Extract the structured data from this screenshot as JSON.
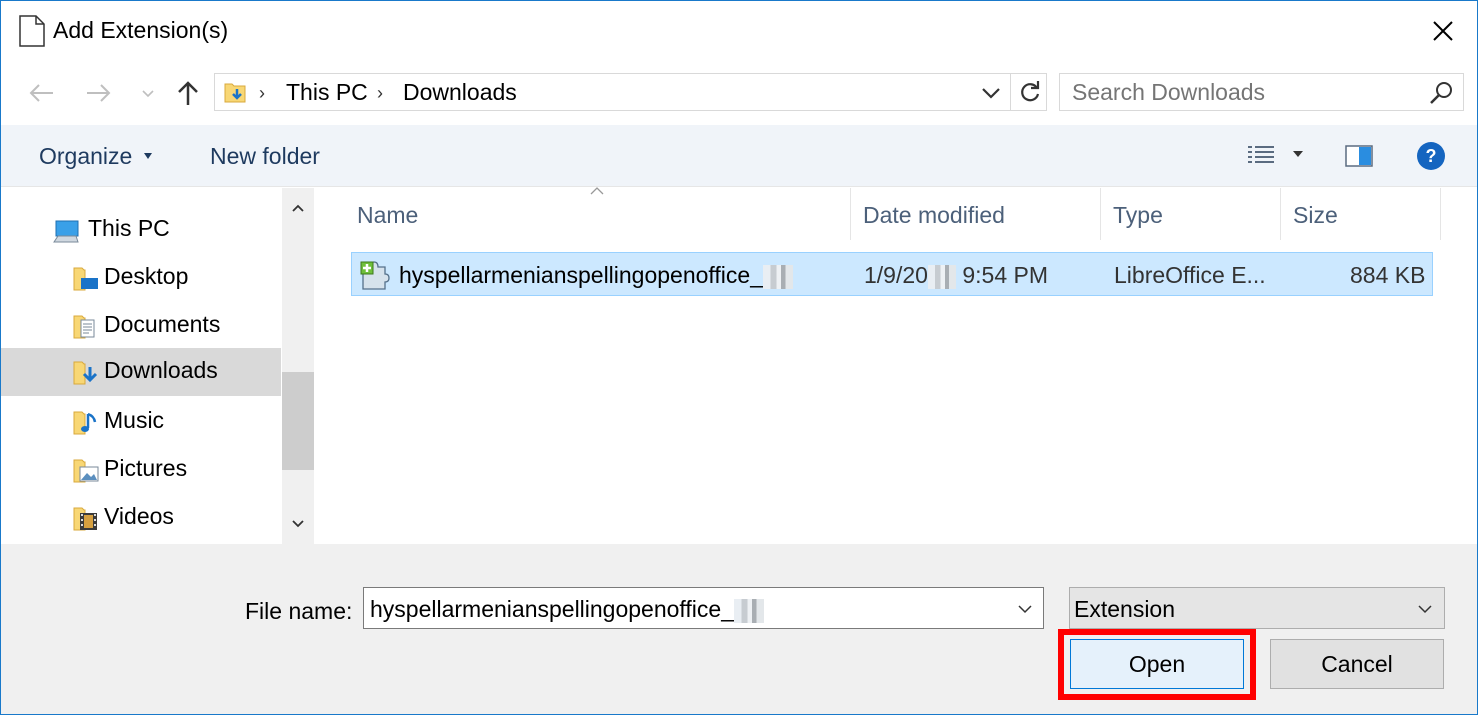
{
  "window": {
    "title": "Add Extension(s)"
  },
  "address_bar": {
    "breadcrumbs": [
      "This PC",
      "Downloads"
    ]
  },
  "search": {
    "placeholder": "Search Downloads"
  },
  "toolbar": {
    "organize_label": "Organize",
    "new_folder_label": "New folder"
  },
  "sidebar": {
    "items": [
      {
        "label": "This PC",
        "icon": "computer-icon"
      },
      {
        "label": "Desktop",
        "icon": "desktop-folder-icon"
      },
      {
        "label": "Documents",
        "icon": "documents-folder-icon"
      },
      {
        "label": "Downloads",
        "icon": "downloads-folder-icon",
        "selected": true
      },
      {
        "label": "Music",
        "icon": "music-folder-icon"
      },
      {
        "label": "Pictures",
        "icon": "pictures-folder-icon"
      },
      {
        "label": "Videos",
        "icon": "videos-folder-icon"
      }
    ]
  },
  "file_list": {
    "columns": [
      "Name",
      "Date modified",
      "Type",
      "Size"
    ],
    "rows": [
      {
        "name": "hyspellarmenianspellingopenoffice_",
        "date_prefix": "1/9/20",
        "date_suffix": "9:54 PM",
        "type": "LibreOffice E...",
        "size": "884 KB",
        "icon": "extension-puzzle-icon",
        "selected": true
      }
    ]
  },
  "footer": {
    "file_name_label": "File name:",
    "file_name_value": "hyspellarmenianspellingopenoffice_",
    "file_type_value": "Extension",
    "open_label": "Open",
    "cancel_label": "Cancel"
  },
  "colors": {
    "selection_bg": "#cce8ff",
    "selection_border": "#99d1ff",
    "highlight": "#ff0000",
    "accent": "#0078d7"
  }
}
